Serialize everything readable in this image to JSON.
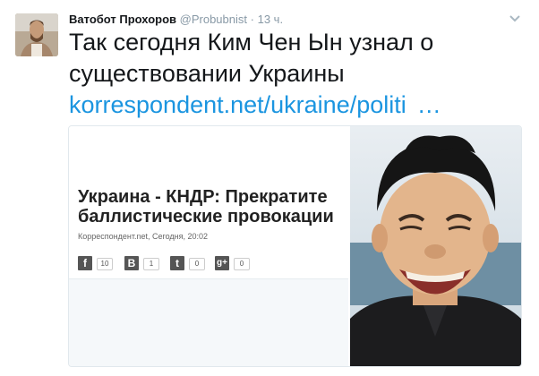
{
  "tweet": {
    "display_name": "Ватобот Прохоров",
    "handle": "@Probubnist",
    "separator": "·",
    "time": "13 ч.",
    "text": "Так сегодня Ким Чен Ын узнал о существовании Украины",
    "link": "korrespondent.net/ukraine/politi",
    "link_ellipsis": "…"
  },
  "icons": {
    "caret": "chevron-down-icon",
    "facebook": "facebook-icon",
    "vk": "vk-icon",
    "twitter": "twitter-icon",
    "googleplus": "google-plus-icon"
  },
  "card": {
    "headline": "Украина - КНДР: Прекратите баллистические провокации",
    "meta": "Корреспондент.net, Сегодня, 20:02",
    "shares": [
      {
        "network": "facebook",
        "glyph": "f",
        "count": "10"
      },
      {
        "network": "vk",
        "glyph": "B",
        "count": "1"
      },
      {
        "network": "twitter",
        "glyph": "t",
        "count": "0"
      },
      {
        "network": "googleplus",
        "glyph": "g+",
        "count": "0"
      }
    ]
  },
  "colors": {
    "link": "#1b95e0",
    "muted": "#8899a6",
    "text": "#14171a",
    "card_border": "#e1e8ed"
  }
}
